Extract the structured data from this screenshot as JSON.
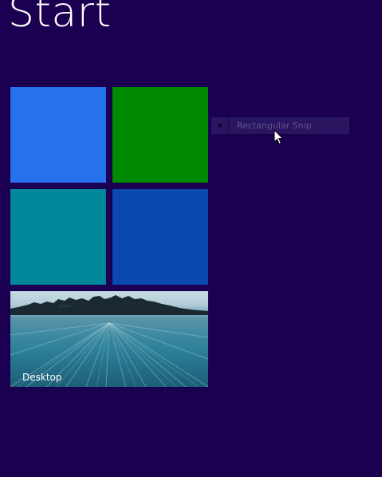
{
  "screen": {
    "title": "Start"
  },
  "tiles": [
    {
      "name": "tile-blue",
      "color": "#2672ec"
    },
    {
      "name": "tile-green",
      "color": "#008a00"
    },
    {
      "name": "tile-teal",
      "color": "#00889a"
    },
    {
      "name": "tile-dark-blue",
      "color": "#0a4ab0"
    },
    {
      "name": "tile-desktop",
      "label": "Desktop"
    }
  ],
  "snip": {
    "label": "Rectangular Snip",
    "icon": "snip-mode-icon"
  },
  "cursor": {
    "icon": "arrow-cursor-icon"
  }
}
